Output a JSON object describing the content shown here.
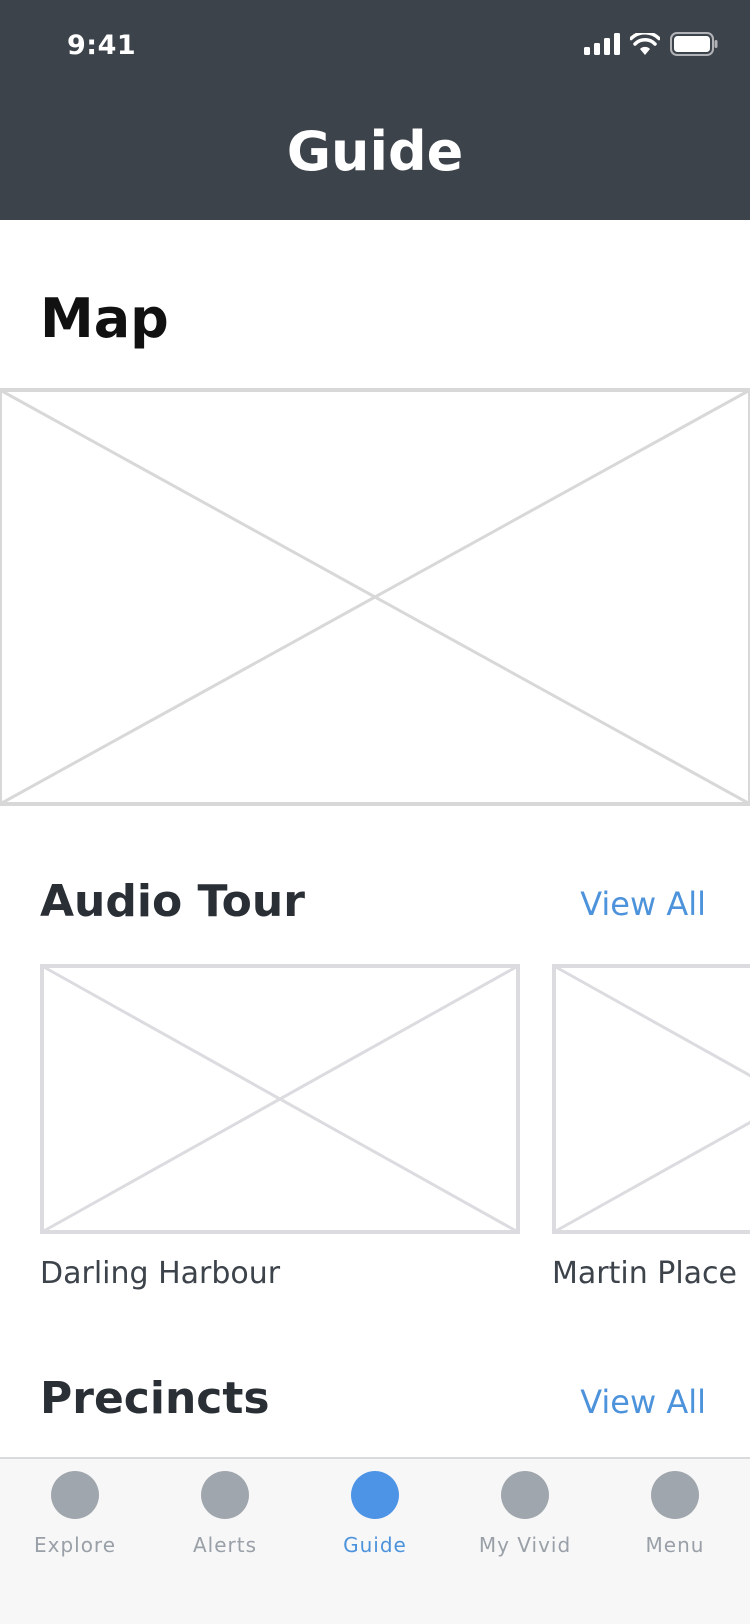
{
  "status_bar": {
    "time": "9:41",
    "icons": [
      "cellular-signal-icon",
      "wifi-icon",
      "battery-icon"
    ]
  },
  "header": {
    "title": "Guide",
    "background_color": "#3d434b"
  },
  "map_section": {
    "heading": "Map"
  },
  "audio_tour": {
    "heading": "Audio Tour",
    "view_all": "View All",
    "cards": [
      {
        "label": "Darling Harbour"
      },
      {
        "label": "Martin Place"
      }
    ]
  },
  "precincts": {
    "heading": "Precincts",
    "view_all": "View All"
  },
  "tab_bar": {
    "active_color": "#4d93e6",
    "tabs": [
      {
        "label": "Explore",
        "active": false
      },
      {
        "label": "Alerts",
        "active": false
      },
      {
        "label": "Guide",
        "active": true
      },
      {
        "label": "My Vivid",
        "active": false
      },
      {
        "label": "Menu",
        "active": false
      }
    ]
  }
}
